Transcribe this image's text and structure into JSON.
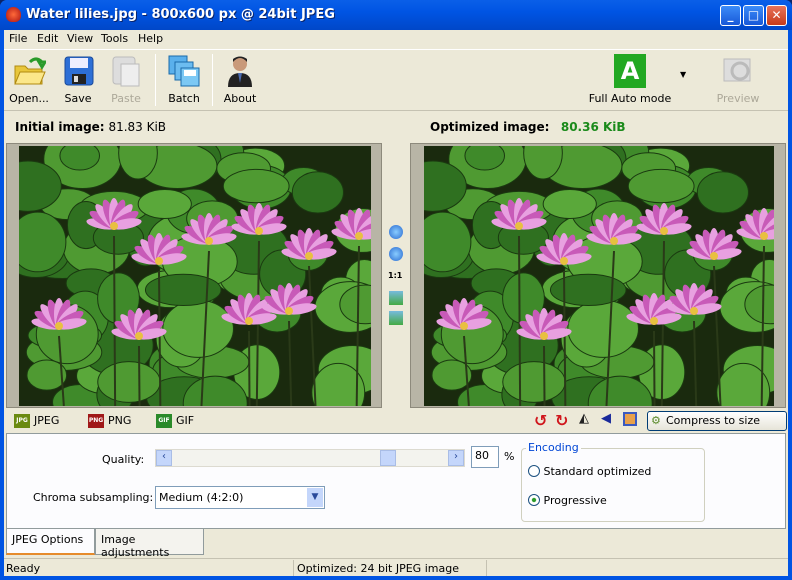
{
  "window": {
    "title": "Water lilies.jpg - 800x600 px @ 24bit JPEG",
    "minimize": "_",
    "maximize": "□",
    "close": "✕"
  },
  "menu": [
    "File",
    "Edit",
    "View",
    "Tools",
    "Help"
  ],
  "toolbar": {
    "open": "Open...",
    "save": "Save",
    "paste": "Paste",
    "batch": "Batch",
    "about": "About",
    "mode_letter": "A",
    "mode": "Full Auto mode",
    "preview": "Preview"
  },
  "images": {
    "initial_label": "Initial image:",
    "initial_size": "81.83 KiB",
    "optimized_label": "Optimized image:",
    "optimized_size": "80.36 KiB",
    "size_color": "#1a8a1a"
  },
  "view_controls": {
    "zoom_in": "zoom-in-icon",
    "zoom_out": "zoom-out-icon",
    "actual": "1:1"
  },
  "format_tabs": [
    {
      "label": "JPEG",
      "icon": "JPG"
    },
    {
      "label": "PNG",
      "icon": "PNG"
    },
    {
      "label": "GIF",
      "icon": "GIF"
    }
  ],
  "compress_button": "Compress to size",
  "options": {
    "quality_label": "Quality:",
    "quality_value": "80",
    "quality_unit": "%",
    "quality_percent": 80,
    "chroma_label": "Chroma subsampling:",
    "chroma_value": "Medium (4:2:0)",
    "encoding_title": "Encoding",
    "encoding_options": [
      "Standard optimized",
      "Progressive"
    ],
    "encoding_selected": "Progressive"
  },
  "bottom_tabs": [
    "JPEG Options",
    "Image adjustments"
  ],
  "status": {
    "left": "Ready",
    "middle": "Optimized: 24 bit JPEG image"
  }
}
